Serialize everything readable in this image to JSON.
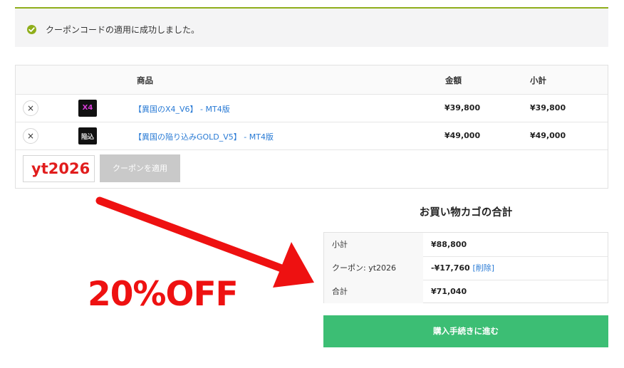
{
  "notice": {
    "message": "クーポンコードの適用に成功しました。"
  },
  "cart": {
    "headers": {
      "product": "商品",
      "price": "金額",
      "subtotal": "小計"
    },
    "items": [
      {
        "name": "【異国のX4_V6】 - MT4版",
        "price": "¥39,800",
        "subtotal": "¥39,800",
        "thumb_text": "X4"
      },
      {
        "name": "【異国の陥り込みGOLD_V5】 - MT4版",
        "price": "¥49,000",
        "subtotal": "¥49,000",
        "thumb_text": "陥込"
      }
    ],
    "remove_symbol": "×",
    "coupon_value": "yt2026",
    "coupon_button": "クーポンを適用"
  },
  "promo": {
    "text": "20%OFF"
  },
  "totals": {
    "title": "お買い物カゴの合計",
    "subtotal_label": "小計",
    "subtotal_value": "¥88,800",
    "coupon_label": "クーポン: yt2026",
    "coupon_value": "-¥17,760",
    "coupon_remove": "[削除]",
    "total_label": "合計",
    "total_value": "¥71,040"
  },
  "checkout_label": "購入手続きに進む",
  "colors": {
    "accent_green": "#8fae1b",
    "checkout_green": "#3cbe74",
    "link_blue": "#2a7bd5",
    "promo_red": "#ee1111"
  }
}
